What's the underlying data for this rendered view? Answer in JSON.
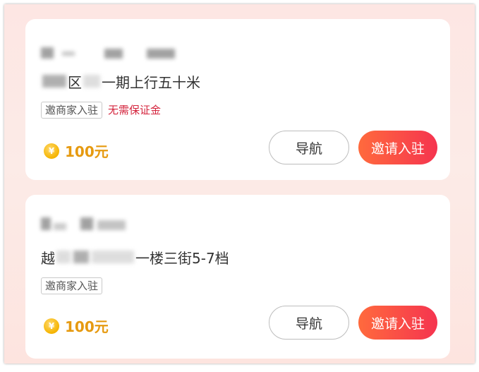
{
  "listings": [
    {
      "address_prefix": "区",
      "address_suffix": "一期上行五十米",
      "tags": [
        "邀商家入驻"
      ],
      "deposit_note": "无需保证金",
      "price": "100元",
      "coin_symbol": "¥",
      "nav_label": "导航",
      "invite_label": "邀请入驻"
    },
    {
      "address_prefix": "越",
      "address_suffix": "一楼三街5-7档",
      "tags": [
        "邀商家入驻"
      ],
      "deposit_note": "",
      "price": "100元",
      "coin_symbol": "¥",
      "nav_label": "导航",
      "invite_label": "邀请入驻"
    }
  ],
  "colors": {
    "background": "#fde8e4",
    "price": "#e69a10",
    "deposit_note": "#d4243d",
    "invite_gradient_start": "#ff6a3d",
    "invite_gradient_end": "#f5344f"
  },
  "icons": {
    "coin": "yen-coin-icon"
  }
}
